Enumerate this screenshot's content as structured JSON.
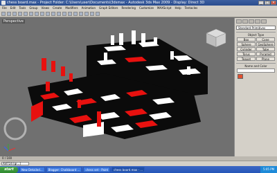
{
  "titlebar": {
    "text": "chess board.max - Project Folder: C:\\Users\\user\\Documents\\3dsmax - Autodesk 3ds Max 2009 - Display: Direct 3D",
    "buttons": [
      "_",
      "□",
      "×"
    ]
  },
  "menubar": {
    "items": [
      "File",
      "Edit",
      "Tools",
      "Group",
      "Views",
      "Create",
      "Modifiers",
      "Animation",
      "Graph Editors",
      "Rendering",
      "Customize",
      "MAXScript",
      "Help",
      "Tentacles"
    ]
  },
  "viewport": {
    "label": "Perspective",
    "colors": {
      "red": "#e8110f",
      "white": "#ffffff",
      "black": "#0b0b0b",
      "background": "#707070"
    }
  },
  "command_panel": {
    "dropdown": "Standard Primitives",
    "section_object_type": "Object Type",
    "buttons": [
      "Box",
      "Cone",
      "Sphere",
      "GeoSphere",
      "Cylinder",
      "Tube",
      "Torus",
      "Pyramid",
      "Teapot",
      "Plane"
    ],
    "section_name_color": "Name and Color"
  },
  "statusbar": {
    "timeslider": "0 / 100",
    "maxscript_label": "AVIT24 [gr...]"
  },
  "taskbar": {
    "start": "start",
    "items": [
      "New Detailed...",
      "Blogger: Chalkboard ...",
      "chess set - Paint",
      "chess board.max - ..."
    ],
    "clock": "5:05 PM"
  }
}
